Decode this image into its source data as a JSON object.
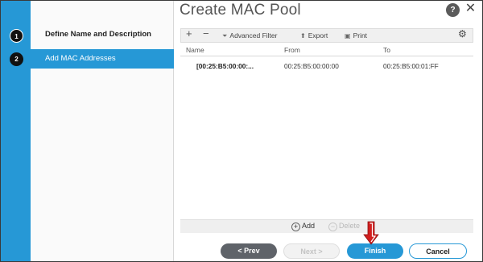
{
  "dialog": {
    "title": "Create MAC Pool",
    "help_glyph": "?",
    "close_glyph": "✕"
  },
  "wizard": {
    "steps": [
      {
        "number": "1",
        "label": "Define Name and Description",
        "state": "done"
      },
      {
        "number": "2",
        "label": "Add MAC Addresses",
        "state": "active"
      }
    ]
  },
  "toolbar": {
    "add_glyph": "+",
    "remove_glyph": "−",
    "advanced_filter": "Advanced Filter",
    "export": "Export",
    "print": "Print"
  },
  "table": {
    "columns": [
      "Name",
      "From",
      "To"
    ],
    "rows": [
      {
        "name": "[00:25:B5:00:00:...",
        "from": "00:25:B5:00:00:00",
        "to": "00:25:B5:00:01:FF"
      }
    ]
  },
  "table_actions": {
    "add": "Add",
    "delete": "Delete"
  },
  "footer": {
    "prev": "< Prev",
    "next": "Next >",
    "finish": "Finish",
    "cancel": "Cancel"
  },
  "colors": {
    "accent": "#2698d6",
    "annotation_arrow": "#d11f1f"
  },
  "icons": {
    "filter": "funnel-icon",
    "export": "arrow-up-icon",
    "print": "printer-icon",
    "settings": "gear-icon"
  }
}
